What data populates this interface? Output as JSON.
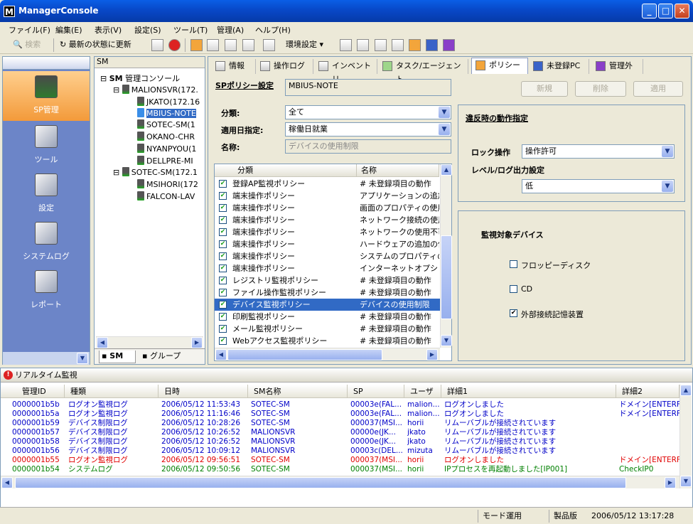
{
  "window": {
    "title": "ManagerConsole",
    "logo": "M"
  },
  "menu": [
    "ファイル(F)",
    "編集(E)",
    "表示(V)",
    "設定(S)",
    "ツール(T)",
    "管理(A)",
    "ヘルプ(H)"
  ],
  "toolbar": {
    "search": "検索",
    "refresh": "最新の状態に更新",
    "env": "環境設定"
  },
  "leftnav": {
    "items": [
      {
        "label": "SP管理",
        "icon": "sp-icon"
      },
      {
        "label": "ツール",
        "icon": "tool-icon"
      },
      {
        "label": "設定",
        "icon": "settings-icon"
      },
      {
        "label": "システムログ",
        "icon": "systemlog-icon"
      },
      {
        "label": "レポート",
        "icon": "report-icon"
      }
    ]
  },
  "tree": {
    "header": "SM",
    "root": "管理コンソール",
    "root_badge": "SM",
    "nodes": [
      {
        "label": "MALIONSVR(172.",
        "level": 1
      },
      {
        "label": "JKATO(172.16",
        "level": 2
      },
      {
        "label": "MBIUS-NOTE",
        "level": 2
      },
      {
        "label": "SOTEC-SM(1",
        "level": 2
      },
      {
        "label": "OKANO-CHR",
        "level": 2
      },
      {
        "label": "NYANPYOU(1",
        "level": 2
      },
      {
        "label": "DELLPRE-MI",
        "level": 2
      },
      {
        "label": "SOTEC-SM(172.1",
        "level": 1
      },
      {
        "label": "MSIHORI(172",
        "level": 2
      },
      {
        "label": "FALCON-LAV",
        "level": 2
      }
    ],
    "tabs": [
      "SM",
      "グループ"
    ]
  },
  "tabs": [
    "情報",
    "操作ログ",
    "インベントリ",
    "タスク/エージェント",
    "ポリシー",
    "未登録PC",
    "管理外"
  ],
  "policy": {
    "title": "SPポリシー設定",
    "pc": "MBIUS-NOTE",
    "category_label": "分類:",
    "category": "全て",
    "date_label": "適用日指定:",
    "date": "稼働日就業",
    "name_label": "名称:",
    "name": "デバイスの使用制限",
    "buttons": [
      "新規",
      "削除",
      "適用"
    ],
    "list_headers": [
      "分類",
      "名称"
    ],
    "rows": [
      [
        "登録AP監視ポリシー",
        "# 未登録項目の動作"
      ],
      [
        "端末操作ポリシー",
        "アプリケーションの追加と"
      ],
      [
        "端末操作ポリシー",
        "画面のプロパティの使用"
      ],
      [
        "端末操作ポリシー",
        "ネットワーク接続の使用"
      ],
      [
        "端末操作ポリシー",
        "ネットワークの使用不可"
      ],
      [
        "端末操作ポリシー",
        "ハードウェアの追加の使"
      ],
      [
        "端末操作ポリシー",
        "システムのプロパティの使"
      ],
      [
        "端末操作ポリシー",
        "インターネットオプション("
      ],
      [
        "レジストリ監視ポリシー",
        "# 未登録項目の動作"
      ],
      [
        "ファイル操作監視ポリシー",
        "# 未登録項目の動作"
      ],
      [
        "デバイス監視ポリシー",
        "デバイスの使用制限"
      ],
      [
        "印刷監視ポリシー",
        "# 未登録項目の動作"
      ],
      [
        "メール監視ポリシー",
        "# 未登録項目の動作"
      ],
      [
        "Webアクセス監視ポリシー",
        "# 未登録項目の動作"
      ]
    ],
    "selected_row": 10
  },
  "violation": {
    "title": "違反時の動作指定",
    "lock_label": "ロック操作",
    "lock": "操作許可",
    "level_label": "レベル/ログ出力設定",
    "level": "低"
  },
  "devices": {
    "title": "監視対象デバイス",
    "items": [
      {
        "label": "フロッピーディスク",
        "checked": false
      },
      {
        "label": "CD",
        "checked": false
      },
      {
        "label": "外部接続記憶装置",
        "checked": true
      }
    ]
  },
  "realtime": {
    "title": "リアルタイム監視",
    "headers": [
      "管理ID",
      "種類",
      "日時",
      "SM名称",
      "SP",
      "ユーザ",
      "詳細1",
      "詳細2"
    ],
    "rows": [
      {
        "id": "0000001b5b",
        "type": "ログオン監視ログ",
        "date": "2006/05/12 11:53:43",
        "sm": "SOTEC-SM",
        "sp": "00003e(FAL...",
        "user": "malion...",
        "d1": "ログオンしました",
        "d2": "ドメイン[ENTERF",
        "color": "#0000c8"
      },
      {
        "id": "0000001b5a",
        "type": "ログオン監視ログ",
        "date": "2006/05/12 11:16:46",
        "sm": "SOTEC-SM",
        "sp": "00003e(FAL...",
        "user": "malion...",
        "d1": "ログオンしました",
        "d2": "ドメイン[ENTERF",
        "color": "#0000c8"
      },
      {
        "id": "0000001b59",
        "type": "デバイス制限ログ",
        "date": "2006/05/12 10:28:26",
        "sm": "SOTEC-SM",
        "sp": "000037(MSI...",
        "user": "horii",
        "d1": "リムーバブルが接続されています",
        "d2": "",
        "color": "#0000c8"
      },
      {
        "id": "0000001b57",
        "type": "デバイス制限ログ",
        "date": "2006/05/12 10:26:52",
        "sm": "MALIONSVR",
        "sp": "00000e(JK...",
        "user": "jkato",
        "d1": "リムーバブルが接続されています",
        "d2": "",
        "color": "#0000c8"
      },
      {
        "id": "0000001b58",
        "type": "デバイス制限ログ",
        "date": "2006/05/12 10:26:52",
        "sm": "MALIONSVR",
        "sp": "00000e(JK...",
        "user": "jkato",
        "d1": "リムーバブルが接続されています",
        "d2": "",
        "color": "#0000c8"
      },
      {
        "id": "0000001b56",
        "type": "デバイス制限ログ",
        "date": "2006/05/12 10:09:12",
        "sm": "MALIONSVR",
        "sp": "00003c(DEL...",
        "user": "mizuta",
        "d1": "リムーバブルが接続されています",
        "d2": "",
        "color": "#0000c8"
      },
      {
        "id": "0000001b55",
        "type": "ログオン監視ログ",
        "date": "2006/05/12 09:56:51",
        "sm": "SOTEC-SM",
        "sp": "000037(MSI...",
        "user": "horii",
        "d1": "ログオンしました",
        "d2": "ドメイン[ENTERF",
        "color": "#e00000"
      },
      {
        "id": "0000001b54",
        "type": "システムログ",
        "date": "2006/05/12 09:50:56",
        "sm": "SOTEC-SM",
        "sp": "000037(MSI...",
        "user": "horii",
        "d1": "IPプロセスを再起動しました[IP001]",
        "d2": "CheckIP0",
        "color": "#008000"
      }
    ]
  },
  "status": {
    "mode": "モード運用",
    "edition": "製品版",
    "datetime": "2006/05/12 13:17:28"
  }
}
